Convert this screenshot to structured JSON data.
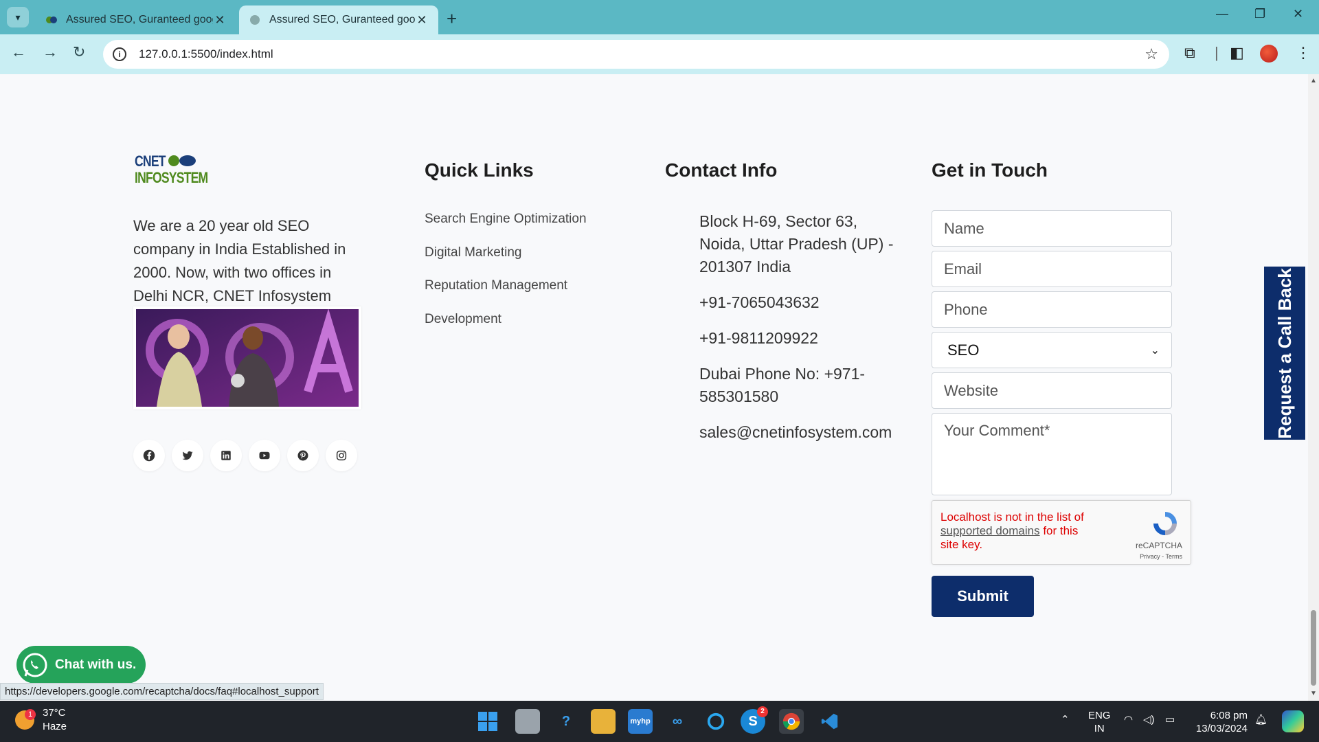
{
  "browser": {
    "tabs": [
      {
        "title": "Assured SEO, Guranteed google"
      },
      {
        "title": "Assured SEO, Guranteed google"
      }
    ],
    "url": "127.0.0.1:5500/index.html"
  },
  "company": {
    "logo_line1": "CNET",
    "logo_line2": "INFOSYSTEM",
    "about": "We are a 20 year old SEO company in India Established in 2000. Now, with two offices in Delhi NCR, CNET Infosystem"
  },
  "quick_links": {
    "title": "Quick Links",
    "items": [
      "Search Engine Optimization",
      "Digital Marketing",
      "Reputation Management",
      "Development"
    ]
  },
  "contact": {
    "title": "Contact Info",
    "address": "Block H-69, Sector 63, Noida, Uttar Pradesh (UP) - 201307 India",
    "phone1": "+91-7065043632",
    "phone2": "+91-9811209922",
    "dubai": "Dubai Phone No: +971-585301580",
    "email": "sales@cnetinfosystem.com"
  },
  "form": {
    "title": "Get in Touch",
    "name_placeholder": "Name",
    "email_placeholder": "Email",
    "phone_placeholder": "Phone",
    "service_selected": "SEO",
    "website_placeholder": "Website",
    "comment_placeholder": "Your Comment*",
    "submit_label": "Submit"
  },
  "recaptcha": {
    "msg_before": "Localhost is not in the list of ",
    "msg_link": "supported domains",
    "msg_after": " for this site key.",
    "brand": "reCAPTCHA",
    "terms": "Privacy - Terms"
  },
  "callback_label": "Request a Call Back",
  "chat_label": "Chat with us.",
  "status_url": "https://developers.google.com/recaptcha/docs/faq#localhost_support",
  "taskbar": {
    "weather_temp": "37°C",
    "weather_desc": "Haze",
    "weather_badge": "1",
    "lang1": "ENG",
    "lang2": "IN",
    "time": "6:08 pm",
    "date": "13/03/2024",
    "skype_badge": "2"
  },
  "colors": {
    "accent": "#0d2d6b",
    "tabbar": "#5bb8c4",
    "chat": "#25a35a"
  }
}
